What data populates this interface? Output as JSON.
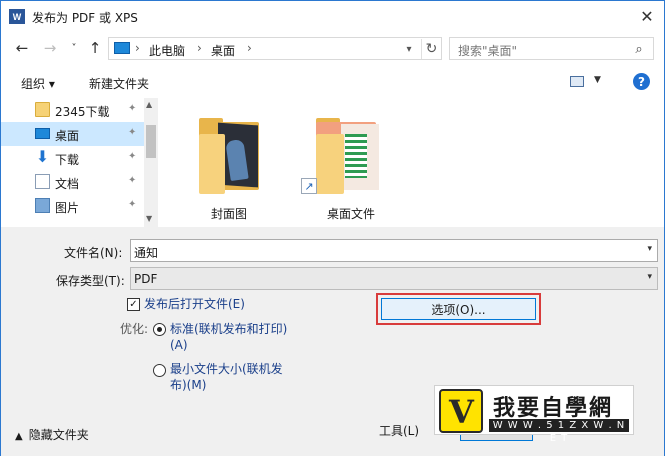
{
  "window": {
    "title": "发布为 PDF 或 XPS",
    "app_icon_letter": "W",
    "close_glyph": "✕"
  },
  "nav": {
    "back": "←",
    "forward": "→",
    "recent": "˅",
    "up": "↑",
    "breadcrumbs": [
      "此电脑",
      "桌面"
    ],
    "crumb_sep": "›",
    "refresh": "↻",
    "search_placeholder": "搜索\"桌面\""
  },
  "toolbar": {
    "organize": "组织 ▾",
    "new_folder": "新建文件夹",
    "help": "?"
  },
  "sidebar": {
    "items": [
      {
        "label": "2345下载",
        "icon": "folder-icon"
      },
      {
        "label": "桌面",
        "icon": "desktop-icon"
      },
      {
        "label": "下载",
        "icon": "download-icon"
      },
      {
        "label": "文档",
        "icon": "document-icon"
      },
      {
        "label": "图片",
        "icon": "pictures-icon"
      }
    ],
    "pin": "📌"
  },
  "files": [
    {
      "name": "封面图",
      "type": "folder"
    },
    {
      "name": "桌面文件",
      "type": "folder-shortcut"
    }
  ],
  "form": {
    "filename_label": "文件名(N):",
    "filename_value": "通知",
    "filetype_label": "保存类型(T):",
    "filetype_value": "PDF",
    "open_after_label": "发布后打开文件(E)",
    "open_after_checked": true,
    "optimize_label": "优化:",
    "optimize_standard_line1": "标准(联机发布和打印)",
    "optimize_standard_line2": "(A)",
    "optimize_min_line1": "最小文件大小(联机发",
    "optimize_min_line2": "布)(M)",
    "options_button": "选项(O)..."
  },
  "footer": {
    "hide_folders": "隐藏文件夹",
    "tools": "工具(L)"
  },
  "watermark": {
    "title": "我要自學網",
    "url": "W W W . 5 1 Z X W . N E T"
  }
}
